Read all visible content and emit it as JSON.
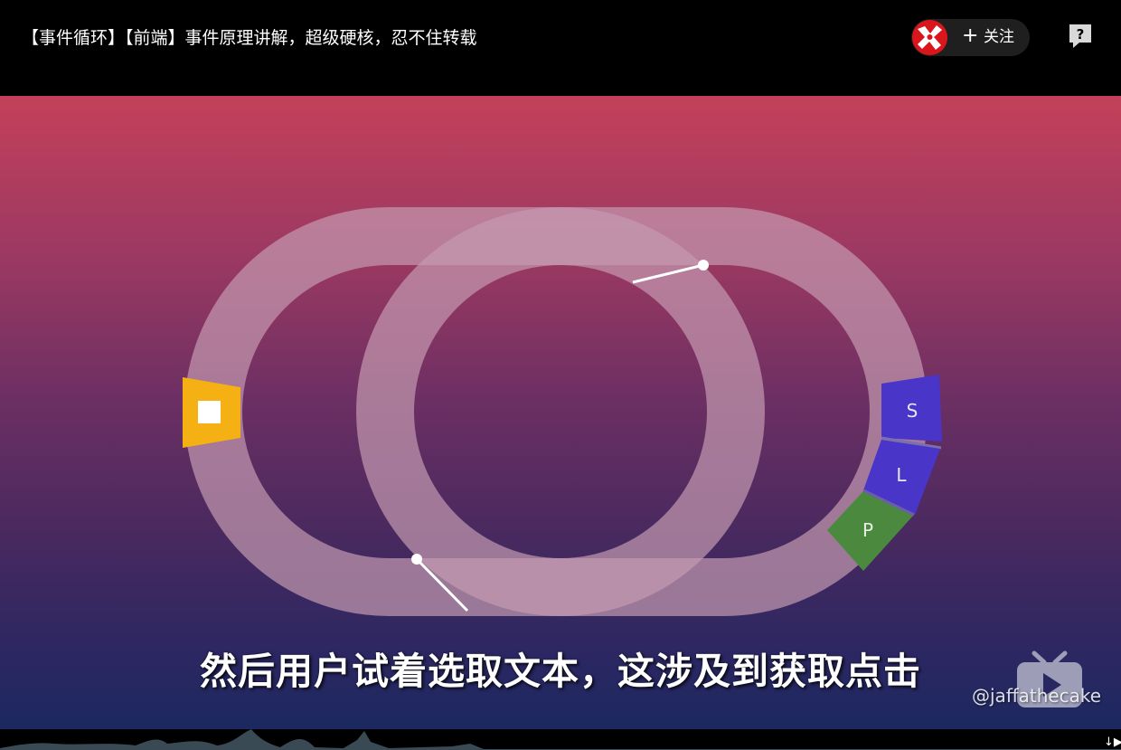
{
  "header": {
    "title": "【事件循环】【前端】事件原理讲解，超级硬核，忍不住转载",
    "follow_label": "关注",
    "follow_plus": "+",
    "avatar_icon": "uploader-avatar",
    "help_icon": "question-mark-icon"
  },
  "video": {
    "subtitle": "然后用户试着选取文本，这涉及到获取点击",
    "watermark": "@jaffathecake",
    "watermark_logo": "tv-play-icon",
    "loop_segments": {
      "render_task": "■",
      "s_label": "S",
      "l_label": "L",
      "p_label": "P"
    },
    "colors": {
      "track": "#c49ab0",
      "render_segment": "#f5b014",
      "s_segment": "#4a35c9",
      "l_segment": "#4a35c9",
      "p_segment": "#4b8a3e",
      "gradient_top": "#c4405a",
      "gradient_bottom": "#1c2860"
    }
  },
  "bottom_bar": {
    "icon": "↓▶"
  }
}
